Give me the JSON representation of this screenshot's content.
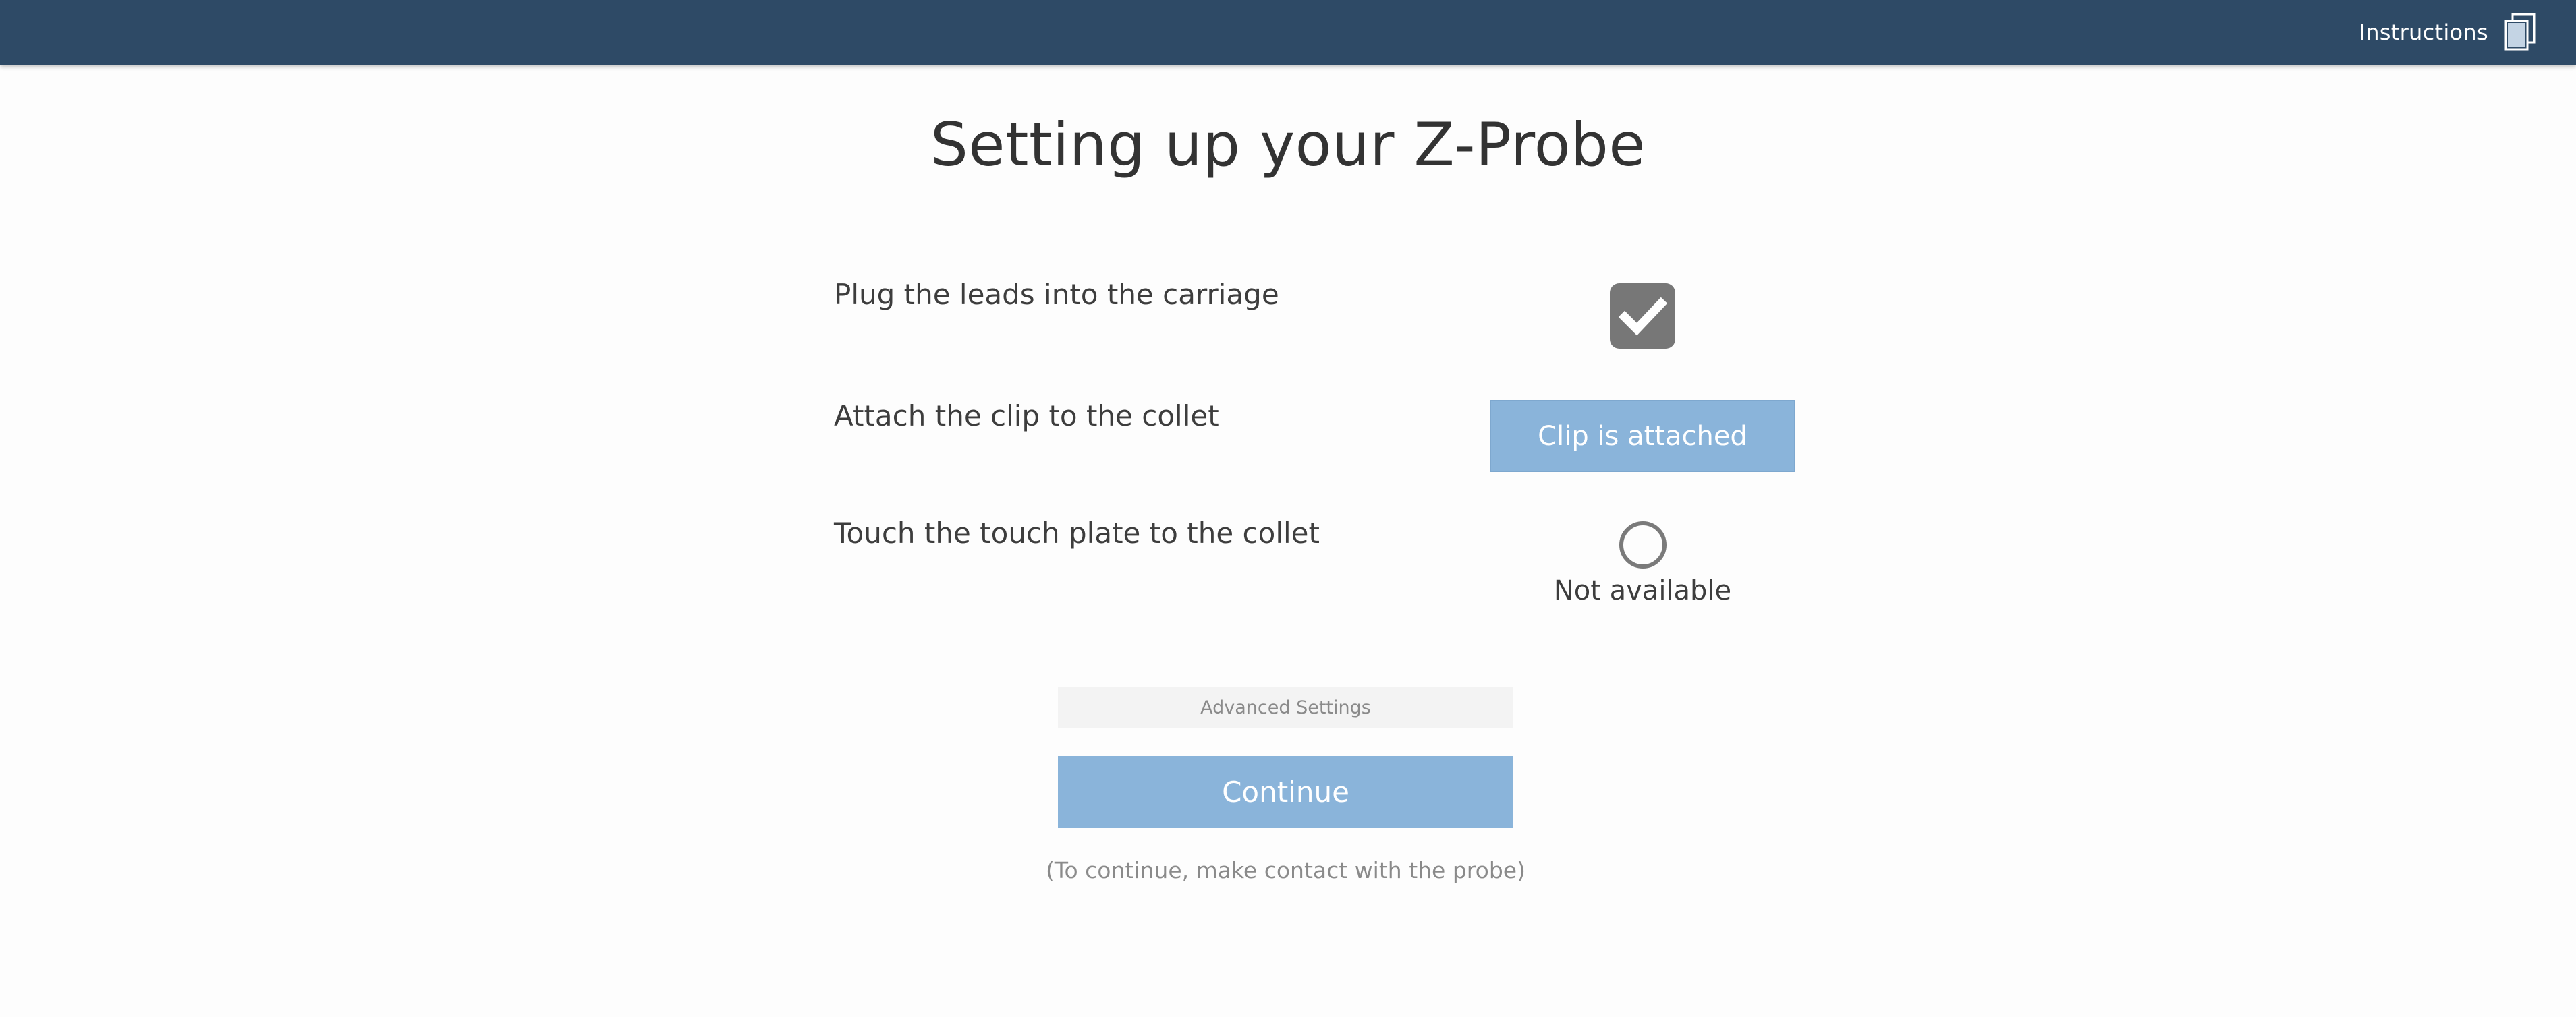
{
  "header": {
    "instructions_label": "Instructions",
    "instructions_icon": "copy-pages-icon",
    "background_color": "#2e4a66"
  },
  "page": {
    "title": "Setting up your Z-Probe"
  },
  "steps": [
    {
      "label": "Plug the leads into the carriage",
      "control": "checkbox",
      "checked": true,
      "icon": "checkmark-icon"
    },
    {
      "label": "Attach the clip to the collet",
      "control": "button",
      "button_label": "Clip is attached"
    },
    {
      "label": "Touch the touch plate to the collet",
      "control": "radio",
      "checked": false,
      "status": "Not available"
    }
  ],
  "advanced_settings_label": "Advanced Settings",
  "continue_button_label": "Continue",
  "continue_hint": "(To continue, make contact with the probe)",
  "colors": {
    "accent_button": "#8ab4da",
    "checkbox_fill": "#777777"
  }
}
